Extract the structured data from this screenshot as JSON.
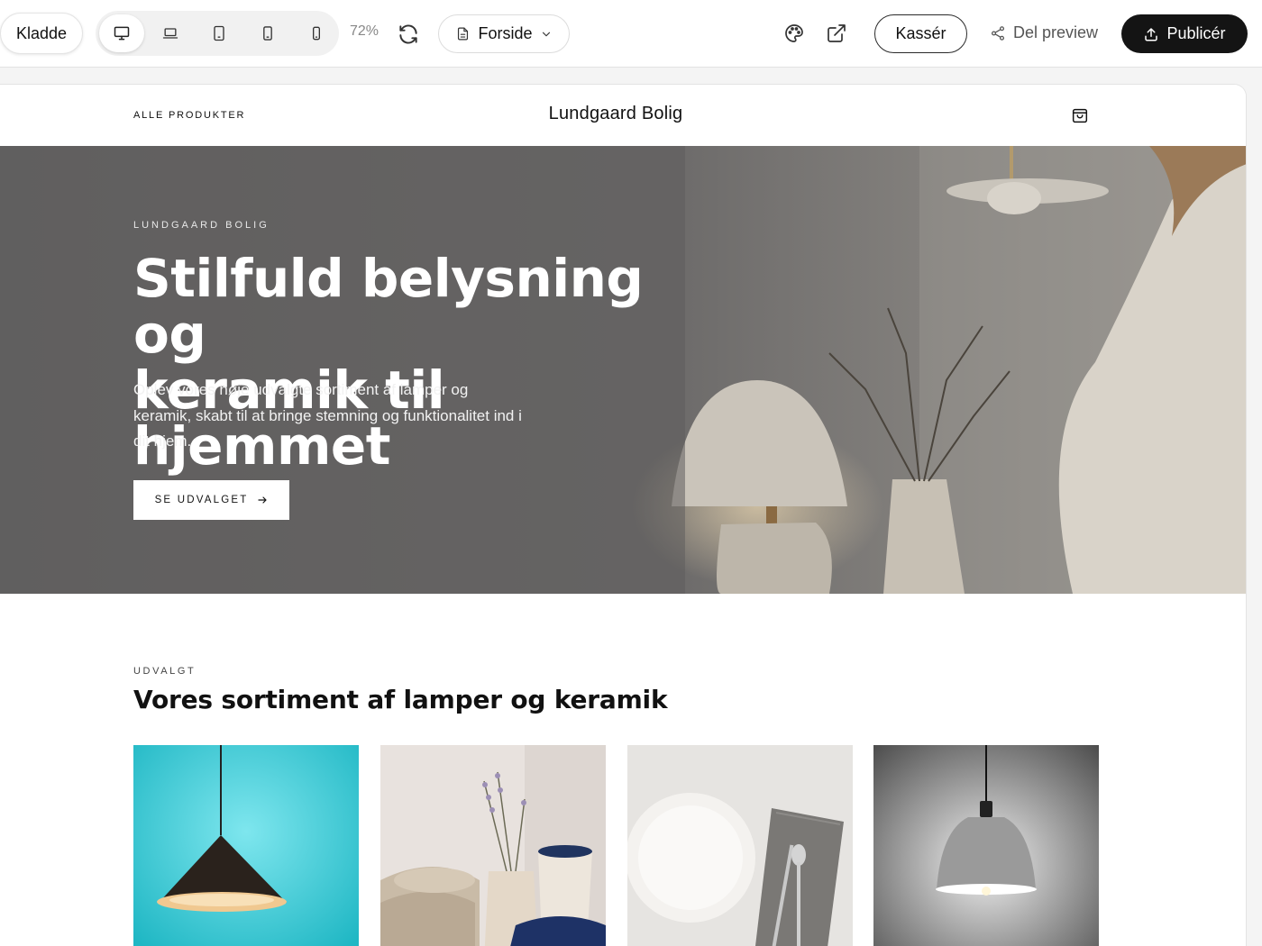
{
  "toolbar": {
    "draft_label": "Kladde",
    "devices": [
      {
        "name": "desktop",
        "active": true
      },
      {
        "name": "laptop",
        "active": false
      },
      {
        "name": "tablet",
        "active": false
      },
      {
        "name": "tablet-small",
        "active": false
      },
      {
        "name": "mobile",
        "active": false
      }
    ],
    "zoom": "72%",
    "page_select": "Forside",
    "discard_label": "Kassér",
    "share_label": "Del preview",
    "publish_label": "Publicér"
  },
  "site": {
    "nav": {
      "all_products": "ALLE PRODUKTER",
      "brand": "Lundgaard Bolig"
    },
    "hero": {
      "eyebrow": "LUNDGAARD BOLIG",
      "title_line1": "Stilfuld belysning og",
      "title_line2": "keramik til hjemmet",
      "subtitle": "Oplev vores nøje udvalgte sortiment af lamper og keramik, skabt til at bringe stemning og funktionalitet ind i dit hjem.",
      "cta": "SE UDVALGET"
    },
    "section": {
      "eyebrow": "UDVALGT",
      "title": "Vores sortiment af lamper og keramik"
    },
    "products": [
      {
        "image": "black-pendant-lamp-teal-background"
      },
      {
        "image": "ceramic-bowls-vases-lavender"
      },
      {
        "image": "white-ceramic-plate-cutlery"
      },
      {
        "image": "grey-pendant-lamp"
      }
    ]
  },
  "colors": {
    "publish_bg": "#141414",
    "hero_overlay": "#6b6a69",
    "product1_bg": "#2cc3cf"
  }
}
